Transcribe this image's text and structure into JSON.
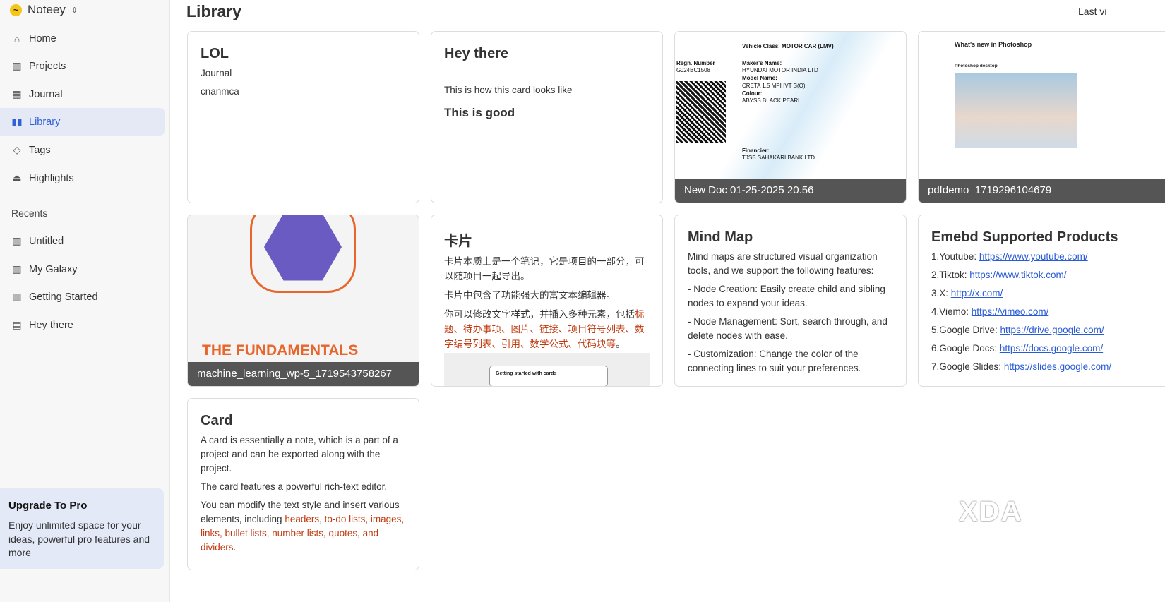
{
  "sidebar": {
    "brand": "Noteey",
    "nav": [
      {
        "label": "Home",
        "icon": "home-icon"
      },
      {
        "label": "Projects",
        "icon": "map-icon"
      },
      {
        "label": "Journal",
        "icon": "calendar-icon"
      },
      {
        "label": "Library",
        "icon": "library-icon",
        "active": true
      },
      {
        "label": "Tags",
        "icon": "tag-icon"
      },
      {
        "label": "Highlights",
        "icon": "highlighter-icon"
      }
    ],
    "recents_label": "Recents",
    "recents": [
      {
        "label": "Untitled"
      },
      {
        "label": "My Galaxy"
      },
      {
        "label": "Getting Started"
      },
      {
        "label": "Hey there"
      }
    ],
    "upgrade": {
      "title": "Upgrade To Pro",
      "text": "Enjoy unlimited space for your ideas, powerful pro features and more"
    }
  },
  "main": {
    "title": "Library",
    "sort_label": "Last vi",
    "cards": {
      "lol": {
        "title": "LOL",
        "lines": [
          "Journal",
          "cnanmca"
        ]
      },
      "hey": {
        "title": "Hey there",
        "line1": "This is how this card looks like",
        "line2": "This is good"
      },
      "doc": {
        "caption": "New Doc 01-25-2025 20.56",
        "lines": [
          "Vehicle Class: MOTOR CAR (LMV)",
          "Regn. Number",
          "GJ24BC1508",
          "Maker's Name:",
          "HYUNDAI MOTOR INDIA LTD",
          "Model Name:",
          "CRETA 1.5 MPI IVT S(O)",
          "Colour:",
          "ABYSS BLACK PEARL",
          "Financier:",
          "TJSB SAHAKARI BANK LTD"
        ]
      },
      "pdf": {
        "caption": "pdfdemo_1719296104679",
        "heading": "What's new in Photoshop",
        "sub": "Photoshop desktop"
      },
      "ml": {
        "caption": "machine_learning_wp-5_1719543758267",
        "banner": "THE FUNDAMENTALS"
      },
      "zh": {
        "title": "卡片",
        "p1": "卡片本质上是一个笔记，它是项目的一部分，可以随项目一起导出。",
        "p2": "卡片中包含了功能强大的富文本编辑器。",
        "p3a": "你可以修改文字样式，并插入多种元素，包括",
        "p3b": "标题、待办事项、图片、链接、项目符号列表、数字编号列表、引用、数学公式、代码块等",
        "p3c": "。",
        "preview": "Getting started with cards"
      },
      "mind": {
        "title": "Mind Map",
        "lines": [
          "Mind maps are structured visual organization tools, and we support the following features:",
          "- Node Creation: Easily create child and sibling nodes to expand your ideas.",
          "- Node Management: Sort, search through, and delete nodes with ease.",
          "- Customization: Change the color of the connecting lines to suit your preferences."
        ]
      },
      "embed": {
        "title": "Emebd Supported Products",
        "items": [
          {
            "label": "1.Youtube: ",
            "url": "https://www.youtube.com/"
          },
          {
            "label": "2.Tiktok: ",
            "url": "https://www.tiktok.com/"
          },
          {
            "label": "3.X: ",
            "url": "http://x.com/"
          },
          {
            "label": "4.Viemo: ",
            "url": "https://vimeo.com/"
          },
          {
            "label": "5.Google Drive: ",
            "url": "https://drive.google.com/"
          },
          {
            "label": "6.Google Docs: ",
            "url": "https://docs.google.com/"
          },
          {
            "label": "7.Google Slides: ",
            "url": "https://slides.google.com/"
          }
        ]
      },
      "card": {
        "title": "Card",
        "p1": "A card is essentially a note, which is a part of a project and can be exported along with the project.",
        "p2": "The card features a powerful rich-text editor.",
        "p3a": "You can modify the text style and insert various elements, including ",
        "p3b": "headers, to-do lists, images, links, bullet lists, number lists, quotes, and dividers",
        "p3c": "."
      }
    }
  },
  "watermark": "XDA"
}
